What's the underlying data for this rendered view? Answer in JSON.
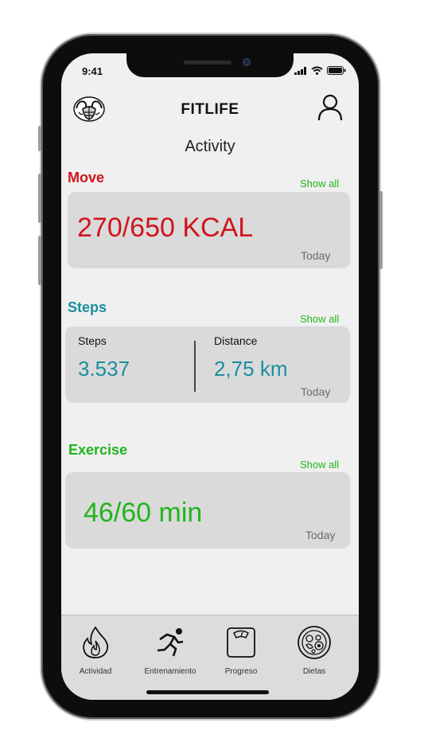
{
  "status_bar": {
    "time": "9:41",
    "icons": [
      "signal-icon",
      "wifi-icon",
      "battery-icon"
    ]
  },
  "header": {
    "app_title": "FITLIFE",
    "logo_icon": "muscle-logo-icon",
    "profile_icon": "user-profile-icon"
  },
  "page": {
    "title": "Activity"
  },
  "move": {
    "label": "Move",
    "show_all": "Show all",
    "value": "270/650 KCAL",
    "period": "Today",
    "color": "#d0141c"
  },
  "steps": {
    "label": "Steps",
    "show_all": "Show all",
    "steps_label": "Steps",
    "steps_value": "3.537",
    "distance_label": "Distance",
    "distance_value": "2,75 km",
    "period": "Today",
    "color": "#1b8e9e"
  },
  "exercise": {
    "label": "Exercise",
    "show_all": "Show all",
    "value": "46/60 min",
    "period": "Today",
    "color": "#22b41e"
  },
  "tabs": [
    {
      "label": "Actividad",
      "icon": "flame-icon"
    },
    {
      "label": "Entrenamiento",
      "icon": "running-icon"
    },
    {
      "label": "Progreso",
      "icon": "scale-icon"
    },
    {
      "label": "Dietas",
      "icon": "diet-plate-icon"
    }
  ]
}
